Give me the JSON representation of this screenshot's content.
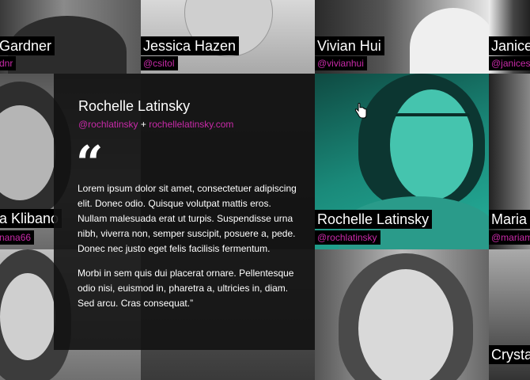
{
  "profiles": [
    {
      "name": "Gardner",
      "handle": "dnr"
    },
    {
      "name": "Jessica Hazen",
      "handle": "@csitol"
    },
    {
      "name": "Vivian Hui",
      "handle": "@vivianhui"
    },
    {
      "name": "Janice",
      "handle": "@janices"
    },
    {
      "name": "a Klibano",
      "handle": "nana66"
    },
    {
      "name": "Rochelle Latinsky",
      "handle": "@rochlatinsky"
    },
    {
      "name": "Maria",
      "handle": "@mariam"
    },
    {
      "name": "Crysta",
      "handle": ""
    }
  ],
  "detail": {
    "name": "Rochelle Latinsky",
    "handle": "@rochlatinsky",
    "separator": "+",
    "website": "rochellelatinsky.com",
    "quote_mark": "“",
    "paragraph1": "Lorem ipsum dolor sit amet, consectetuer adipiscing elit. Donec odio. Quisque volutpat mattis eros. Nullam malesuada erat ut turpis. Suspendisse urna nibh, viverra non, semper suscipit, posuere a, pede. Donec nec justo eget felis facilisis fermentum.",
    "paragraph2": "Morbi in sem quis dui placerat ornare. Pellentesque odio nisi, euismod in, pharetra a, ultricies in, diam. Sed arcu. Cras consequat.”"
  },
  "colors": {
    "handle": "#c82aa8",
    "highlight_tint": "#1caa96",
    "overlay_bg": "#121212"
  }
}
